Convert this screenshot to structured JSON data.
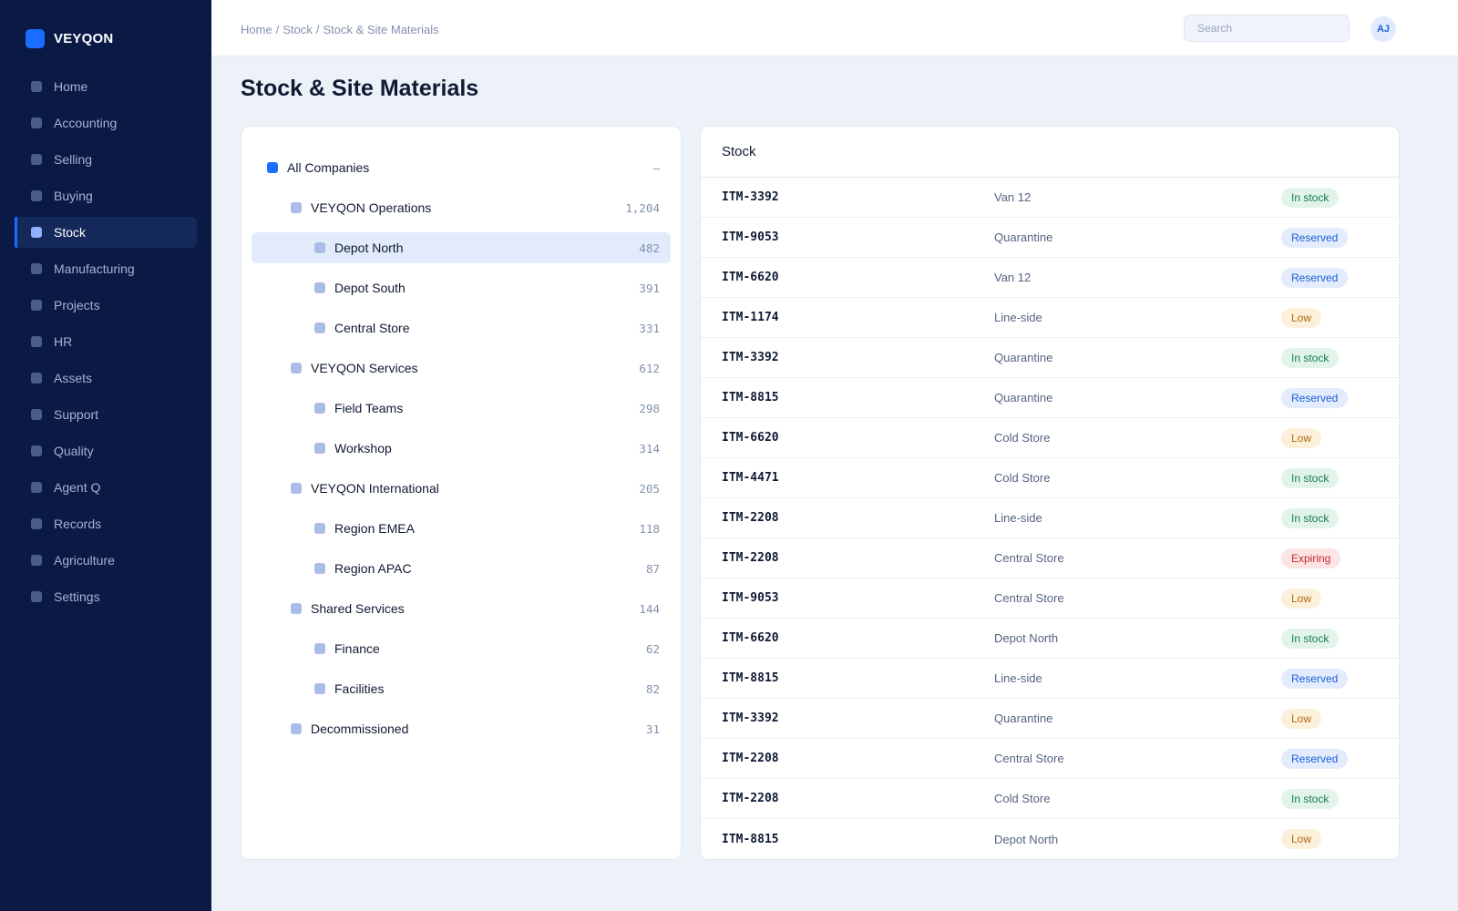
{
  "brand": {
    "name": "VEYQON"
  },
  "sidebar": {
    "items": [
      {
        "label": "Home",
        "active": false
      },
      {
        "label": "Accounting",
        "active": false
      },
      {
        "label": "Selling",
        "active": false
      },
      {
        "label": "Buying",
        "active": false
      },
      {
        "label": "Stock",
        "active": true
      },
      {
        "label": "Manufacturing",
        "active": false
      },
      {
        "label": "Projects",
        "active": false
      },
      {
        "label": "HR",
        "active": false
      },
      {
        "label": "Assets",
        "active": false
      },
      {
        "label": "Support",
        "active": false
      },
      {
        "label": "Quality",
        "active": false
      },
      {
        "label": "Agent Q",
        "active": false
      },
      {
        "label": "Records",
        "active": false
      },
      {
        "label": "Agriculture",
        "active": false
      },
      {
        "label": "Settings",
        "active": false
      }
    ]
  },
  "header": {
    "breadcrumb": [
      "Home",
      "Stock",
      "Stock & Site Materials"
    ],
    "breadcrumb_separator": "/",
    "search": {
      "placeholder": "Search",
      "value": ""
    },
    "avatar_initials": "AJ"
  },
  "page": {
    "title": "Stock & Site Materials"
  },
  "tree": {
    "nodes": [
      {
        "label": "All Companies",
        "count": "–",
        "level": 0,
        "selected": false
      },
      {
        "label": "VEYQON Operations",
        "count": "1,204",
        "level": 1,
        "selected": false
      },
      {
        "label": "Depot North",
        "count": "482",
        "level": 2,
        "selected": true
      },
      {
        "label": "Depot South",
        "count": "391",
        "level": 2,
        "selected": false
      },
      {
        "label": "Central Store",
        "count": "331",
        "level": 2,
        "selected": false
      },
      {
        "label": "VEYQON Services",
        "count": "612",
        "level": 1,
        "selected": false
      },
      {
        "label": "Field Teams",
        "count": "298",
        "level": 2,
        "selected": false
      },
      {
        "label": "Workshop",
        "count": "314",
        "level": 2,
        "selected": false
      },
      {
        "label": "VEYQON International",
        "count": "205",
        "level": 1,
        "selected": false
      },
      {
        "label": "Region EMEA",
        "count": "118",
        "level": 2,
        "selected": false
      },
      {
        "label": "Region APAC",
        "count": "87",
        "level": 2,
        "selected": false
      },
      {
        "label": "Shared Services",
        "count": "144",
        "level": 1,
        "selected": false
      },
      {
        "label": "Finance",
        "count": "62",
        "level": 2,
        "selected": false
      },
      {
        "label": "Facilities",
        "count": "82",
        "level": 2,
        "selected": false
      },
      {
        "label": "Decommissioned",
        "count": "31",
        "level": 1,
        "selected": false
      }
    ]
  },
  "stock": {
    "title": "Stock",
    "rows": [
      {
        "item": "ITM-3392",
        "location": "Van 12",
        "status": "In stock",
        "status_kind": "in-stock"
      },
      {
        "item": "ITM-9053",
        "location": "Quarantine",
        "status": "Reserved",
        "status_kind": "reserved"
      },
      {
        "item": "ITM-6620",
        "location": "Van 12",
        "status": "Reserved",
        "status_kind": "reserved"
      },
      {
        "item": "ITM-1174",
        "location": "Line-side",
        "status": "Low",
        "status_kind": "low"
      },
      {
        "item": "ITM-3392",
        "location": "Quarantine",
        "status": "In stock",
        "status_kind": "in-stock"
      },
      {
        "item": "ITM-8815",
        "location": "Quarantine",
        "status": "Reserved",
        "status_kind": "reserved"
      },
      {
        "item": "ITM-6620",
        "location": "Cold Store",
        "status": "Low",
        "status_kind": "low"
      },
      {
        "item": "ITM-4471",
        "location": "Cold Store",
        "status": "In stock",
        "status_kind": "in-stock"
      },
      {
        "item": "ITM-2208",
        "location": "Line-side",
        "status": "In stock",
        "status_kind": "in-stock"
      },
      {
        "item": "ITM-2208",
        "location": "Central Store",
        "status": "Expiring",
        "status_kind": "expiring"
      },
      {
        "item": "ITM-9053",
        "location": "Central Store",
        "status": "Low",
        "status_kind": "low"
      },
      {
        "item": "ITM-6620",
        "location": "Depot North",
        "status": "In stock",
        "status_kind": "in-stock"
      },
      {
        "item": "ITM-8815",
        "location": "Line-side",
        "status": "Reserved",
        "status_kind": "reserved"
      },
      {
        "item": "ITM-3392",
        "location": "Quarantine",
        "status": "Low",
        "status_kind": "low"
      },
      {
        "item": "ITM-2208",
        "location": "Central Store",
        "status": "Reserved",
        "status_kind": "reserved"
      },
      {
        "item": "ITM-2208",
        "location": "Cold Store",
        "status": "In stock",
        "status_kind": "in-stock"
      },
      {
        "item": "ITM-8815",
        "location": "Depot North",
        "status": "Low",
        "status_kind": "low"
      }
    ]
  },
  "colors": {
    "sidebar_bg": "#0b1a45",
    "accent": "#1a6dff",
    "page_bg": "#edf1f8"
  }
}
